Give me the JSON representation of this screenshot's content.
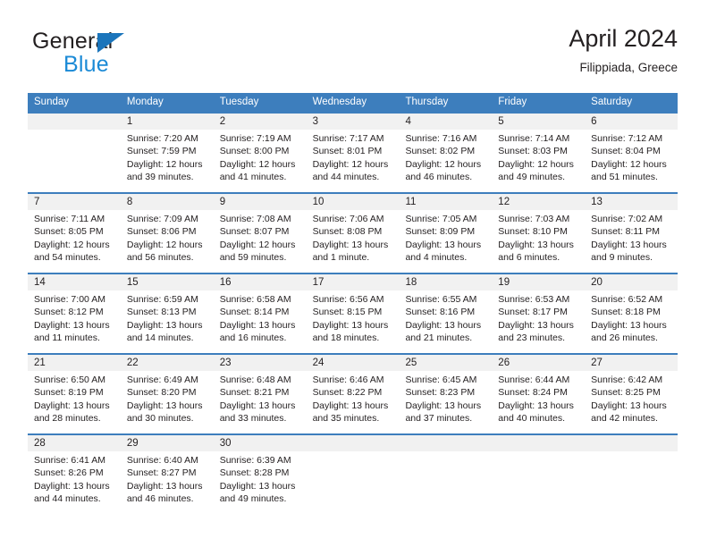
{
  "logo": {
    "word_one": "General",
    "word_two": "Blue",
    "triangle_color": "#1b75bb",
    "blue_text_color": "#1b8ad6"
  },
  "header": {
    "title": "April 2024",
    "subtitle": "Filippiada, Greece",
    "header_bg_color": "#3d7ebd",
    "header_text_color": "#ffffff",
    "daynum_band_color": "#f1f1f1",
    "divider_color": "#3d7ebd"
  },
  "weekdays": [
    "Sunday",
    "Monday",
    "Tuesday",
    "Wednesday",
    "Thursday",
    "Friday",
    "Saturday"
  ],
  "weeks": [
    {
      "days": [
        {
          "num": "",
          "sunrise": "",
          "sunset": "",
          "daylight_line1": "",
          "daylight_line2": ""
        },
        {
          "num": "1",
          "sunrise": "Sunrise: 7:20 AM",
          "sunset": "Sunset: 7:59 PM",
          "daylight_line1": "Daylight: 12 hours",
          "daylight_line2": "and 39 minutes."
        },
        {
          "num": "2",
          "sunrise": "Sunrise: 7:19 AM",
          "sunset": "Sunset: 8:00 PM",
          "daylight_line1": "Daylight: 12 hours",
          "daylight_line2": "and 41 minutes."
        },
        {
          "num": "3",
          "sunrise": "Sunrise: 7:17 AM",
          "sunset": "Sunset: 8:01 PM",
          "daylight_line1": "Daylight: 12 hours",
          "daylight_line2": "and 44 minutes."
        },
        {
          "num": "4",
          "sunrise": "Sunrise: 7:16 AM",
          "sunset": "Sunset: 8:02 PM",
          "daylight_line1": "Daylight: 12 hours",
          "daylight_line2": "and 46 minutes."
        },
        {
          "num": "5",
          "sunrise": "Sunrise: 7:14 AM",
          "sunset": "Sunset: 8:03 PM",
          "daylight_line1": "Daylight: 12 hours",
          "daylight_line2": "and 49 minutes."
        },
        {
          "num": "6",
          "sunrise": "Sunrise: 7:12 AM",
          "sunset": "Sunset: 8:04 PM",
          "daylight_line1": "Daylight: 12 hours",
          "daylight_line2": "and 51 minutes."
        }
      ]
    },
    {
      "days": [
        {
          "num": "7",
          "sunrise": "Sunrise: 7:11 AM",
          "sunset": "Sunset: 8:05 PM",
          "daylight_line1": "Daylight: 12 hours",
          "daylight_line2": "and 54 minutes."
        },
        {
          "num": "8",
          "sunrise": "Sunrise: 7:09 AM",
          "sunset": "Sunset: 8:06 PM",
          "daylight_line1": "Daylight: 12 hours",
          "daylight_line2": "and 56 minutes."
        },
        {
          "num": "9",
          "sunrise": "Sunrise: 7:08 AM",
          "sunset": "Sunset: 8:07 PM",
          "daylight_line1": "Daylight: 12 hours",
          "daylight_line2": "and 59 minutes."
        },
        {
          "num": "10",
          "sunrise": "Sunrise: 7:06 AM",
          "sunset": "Sunset: 8:08 PM",
          "daylight_line1": "Daylight: 13 hours",
          "daylight_line2": "and 1 minute."
        },
        {
          "num": "11",
          "sunrise": "Sunrise: 7:05 AM",
          "sunset": "Sunset: 8:09 PM",
          "daylight_line1": "Daylight: 13 hours",
          "daylight_line2": "and 4 minutes."
        },
        {
          "num": "12",
          "sunrise": "Sunrise: 7:03 AM",
          "sunset": "Sunset: 8:10 PM",
          "daylight_line1": "Daylight: 13 hours",
          "daylight_line2": "and 6 minutes."
        },
        {
          "num": "13",
          "sunrise": "Sunrise: 7:02 AM",
          "sunset": "Sunset: 8:11 PM",
          "daylight_line1": "Daylight: 13 hours",
          "daylight_line2": "and 9 minutes."
        }
      ]
    },
    {
      "days": [
        {
          "num": "14",
          "sunrise": "Sunrise: 7:00 AM",
          "sunset": "Sunset: 8:12 PM",
          "daylight_line1": "Daylight: 13 hours",
          "daylight_line2": "and 11 minutes."
        },
        {
          "num": "15",
          "sunrise": "Sunrise: 6:59 AM",
          "sunset": "Sunset: 8:13 PM",
          "daylight_line1": "Daylight: 13 hours",
          "daylight_line2": "and 14 minutes."
        },
        {
          "num": "16",
          "sunrise": "Sunrise: 6:58 AM",
          "sunset": "Sunset: 8:14 PM",
          "daylight_line1": "Daylight: 13 hours",
          "daylight_line2": "and 16 minutes."
        },
        {
          "num": "17",
          "sunrise": "Sunrise: 6:56 AM",
          "sunset": "Sunset: 8:15 PM",
          "daylight_line1": "Daylight: 13 hours",
          "daylight_line2": "and 18 minutes."
        },
        {
          "num": "18",
          "sunrise": "Sunrise: 6:55 AM",
          "sunset": "Sunset: 8:16 PM",
          "daylight_line1": "Daylight: 13 hours",
          "daylight_line2": "and 21 minutes."
        },
        {
          "num": "19",
          "sunrise": "Sunrise: 6:53 AM",
          "sunset": "Sunset: 8:17 PM",
          "daylight_line1": "Daylight: 13 hours",
          "daylight_line2": "and 23 minutes."
        },
        {
          "num": "20",
          "sunrise": "Sunrise: 6:52 AM",
          "sunset": "Sunset: 8:18 PM",
          "daylight_line1": "Daylight: 13 hours",
          "daylight_line2": "and 26 minutes."
        }
      ]
    },
    {
      "days": [
        {
          "num": "21",
          "sunrise": "Sunrise: 6:50 AM",
          "sunset": "Sunset: 8:19 PM",
          "daylight_line1": "Daylight: 13 hours",
          "daylight_line2": "and 28 minutes."
        },
        {
          "num": "22",
          "sunrise": "Sunrise: 6:49 AM",
          "sunset": "Sunset: 8:20 PM",
          "daylight_line1": "Daylight: 13 hours",
          "daylight_line2": "and 30 minutes."
        },
        {
          "num": "23",
          "sunrise": "Sunrise: 6:48 AM",
          "sunset": "Sunset: 8:21 PM",
          "daylight_line1": "Daylight: 13 hours",
          "daylight_line2": "and 33 minutes."
        },
        {
          "num": "24",
          "sunrise": "Sunrise: 6:46 AM",
          "sunset": "Sunset: 8:22 PM",
          "daylight_line1": "Daylight: 13 hours",
          "daylight_line2": "and 35 minutes."
        },
        {
          "num": "25",
          "sunrise": "Sunrise: 6:45 AM",
          "sunset": "Sunset: 8:23 PM",
          "daylight_line1": "Daylight: 13 hours",
          "daylight_line2": "and 37 minutes."
        },
        {
          "num": "26",
          "sunrise": "Sunrise: 6:44 AM",
          "sunset": "Sunset: 8:24 PM",
          "daylight_line1": "Daylight: 13 hours",
          "daylight_line2": "and 40 minutes."
        },
        {
          "num": "27",
          "sunrise": "Sunrise: 6:42 AM",
          "sunset": "Sunset: 8:25 PM",
          "daylight_line1": "Daylight: 13 hours",
          "daylight_line2": "and 42 minutes."
        }
      ]
    },
    {
      "days": [
        {
          "num": "28",
          "sunrise": "Sunrise: 6:41 AM",
          "sunset": "Sunset: 8:26 PM",
          "daylight_line1": "Daylight: 13 hours",
          "daylight_line2": "and 44 minutes."
        },
        {
          "num": "29",
          "sunrise": "Sunrise: 6:40 AM",
          "sunset": "Sunset: 8:27 PM",
          "daylight_line1": "Daylight: 13 hours",
          "daylight_line2": "and 46 minutes."
        },
        {
          "num": "30",
          "sunrise": "Sunrise: 6:39 AM",
          "sunset": "Sunset: 8:28 PM",
          "daylight_line1": "Daylight: 13 hours",
          "daylight_line2": "and 49 minutes."
        },
        {
          "num": "",
          "sunrise": "",
          "sunset": "",
          "daylight_line1": "",
          "daylight_line2": ""
        },
        {
          "num": "",
          "sunrise": "",
          "sunset": "",
          "daylight_line1": "",
          "daylight_line2": ""
        },
        {
          "num": "",
          "sunrise": "",
          "sunset": "",
          "daylight_line1": "",
          "daylight_line2": ""
        },
        {
          "num": "",
          "sunrise": "",
          "sunset": "",
          "daylight_line1": "",
          "daylight_line2": ""
        }
      ]
    }
  ]
}
